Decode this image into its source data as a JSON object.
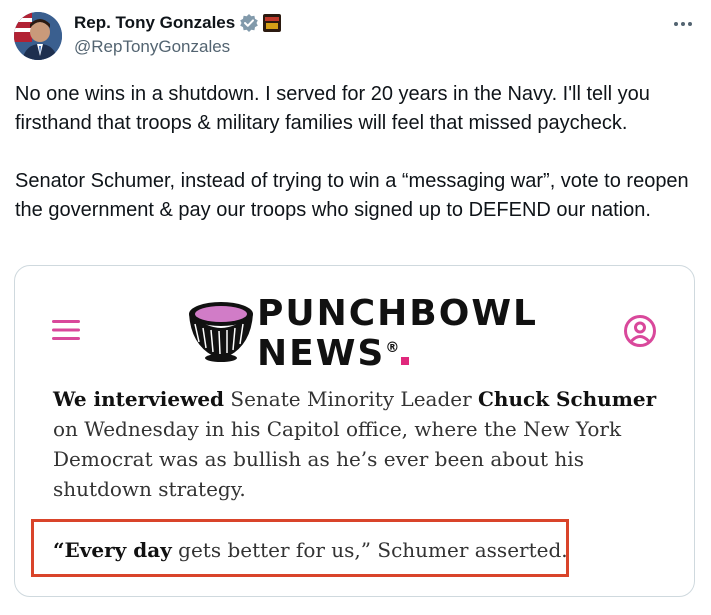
{
  "author": {
    "display_name": "Rep. Tony Gonzales",
    "handle": "@RepTonyGonzales",
    "avatar_icon": "avatar-photo",
    "verified_icon": "verified-badge-icon",
    "affiliation_icon": "affiliation-badge-icon"
  },
  "more_icon": "more-dots-icon",
  "tweet": {
    "text": "No one wins in a shutdown. I served for 20 years in the Navy. I'll tell you firsthand that troops & military families will feel that missed paycheck.\n\nSenator Schumer, instead of trying to win a “messaging war”, vote to reopen the government & pay our troops who signed up to DEFEND our nation."
  },
  "card": {
    "menu_icon": "hamburger-menu-icon",
    "user_icon": "user-circle-icon",
    "brand_line1": "PUNCHBOWL",
    "brand_line2": "NEWS",
    "brand_reg": "®",
    "article": {
      "bold1": "We interviewed",
      "text1": " Senate Minority Leader ",
      "bold2": "Chuck Schumer",
      "text2": " on Wednesday in his Capitol office, where the New York Democrat was as bullish as he’s ever been about his shutdown strategy."
    },
    "quote": {
      "open": "“",
      "bold": "Every day",
      "rest": " gets better for us,” Schumer asserted."
    }
  },
  "colors": {
    "accent_pink": "#d9489b",
    "highlight_red": "#d9442a",
    "verified_gray": "#829aab"
  }
}
